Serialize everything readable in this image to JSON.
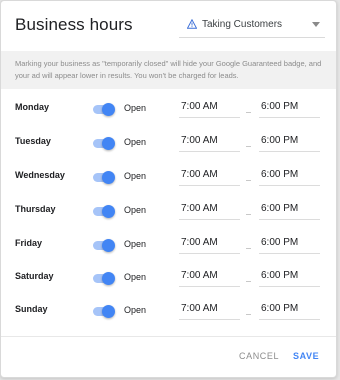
{
  "dialog": {
    "title": "Business hours",
    "status_select": {
      "value": "Taking Customers",
      "icon": "warning-triangle-icon"
    },
    "notice": "Marking your business as \"temporarily closed\" will hide your Google Guaranteed badge, and your ad will appear lower in results. You won't be charged for leads."
  },
  "days": [
    {
      "name": "Monday",
      "enabled": true,
      "status": "Open",
      "open": "7:00 AM",
      "close": "6:00 PM"
    },
    {
      "name": "Tuesday",
      "enabled": true,
      "status": "Open",
      "open": "7:00 AM",
      "close": "6:00 PM"
    },
    {
      "name": "Wednesday",
      "enabled": true,
      "status": "Open",
      "open": "7:00 AM",
      "close": "6:00 PM"
    },
    {
      "name": "Thursday",
      "enabled": true,
      "status": "Open",
      "open": "7:00 AM",
      "close": "6:00 PM"
    },
    {
      "name": "Friday",
      "enabled": true,
      "status": "Open",
      "open": "7:00 AM",
      "close": "6:00 PM"
    },
    {
      "name": "Saturday",
      "enabled": true,
      "status": "Open",
      "open": "7:00 AM",
      "close": "6:00 PM"
    },
    {
      "name": "Sunday",
      "enabled": true,
      "status": "Open",
      "open": "7:00 AM",
      "close": "6:00 PM"
    }
  ],
  "footer": {
    "cancel_label": "CANCEL",
    "save_label": "SAVE"
  },
  "colors": {
    "accent": "#4285f4",
    "toggle_track": "#a6c4f8",
    "notice_bg": "#f1f1f1",
    "warning": "#3c6fd8"
  }
}
